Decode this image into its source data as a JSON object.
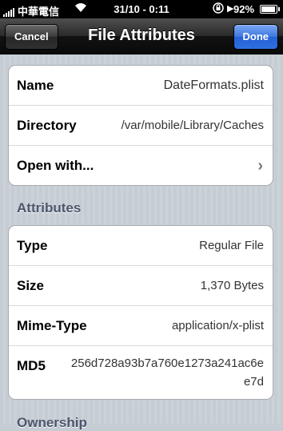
{
  "status_bar": {
    "carrier": "中華電信",
    "time": "31/10 - 0:11",
    "battery_percent": "92%",
    "battery_level": 0.92
  },
  "nav": {
    "title": "File Attributes",
    "cancel_label": "Cancel",
    "done_label": "Done"
  },
  "file_group": {
    "name_label": "Name",
    "name_value": "DateFormats.plist",
    "directory_label": "Directory",
    "directory_value": "/var/mobile/Library/Caches",
    "open_with_label": "Open with..."
  },
  "attributes_header": "Attributes",
  "attributes": {
    "type_label": "Type",
    "type_value": "Regular File",
    "size_label": "Size",
    "size_value": "1,370 Bytes",
    "mime_label": "Mime-Type",
    "mime_value": "application/x-plist",
    "md5_label": "MD5",
    "md5_value": "256d728a93b7a760e1273a241ac6ee7d"
  },
  "next_header": "Ownership"
}
